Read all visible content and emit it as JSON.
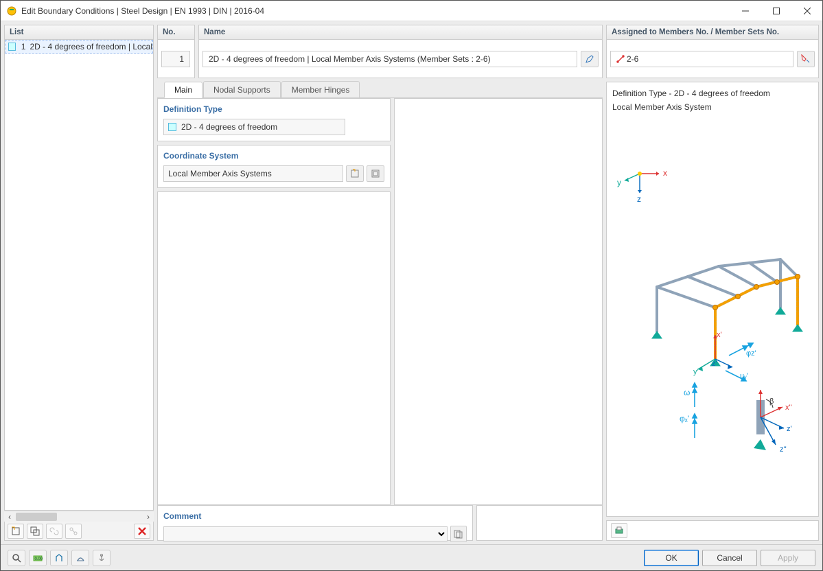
{
  "window": {
    "title": "Edit Boundary Conditions | Steel Design | EN 1993 | DIN | 2016-04"
  },
  "list": {
    "header": "List",
    "rows": [
      {
        "num": "1",
        "text": "2D - 4 degrees of freedom | Local"
      }
    ]
  },
  "fields": {
    "no_label": "No.",
    "no_value": "1",
    "name_label": "Name",
    "name_value": "2D - 4 degrees of freedom | Local Member Axis Systems (Member Sets : 2-6)",
    "assigned_label": "Assigned to Members No. / Member Sets No.",
    "assigned_value": "2-6"
  },
  "tabs": {
    "items": [
      "Main",
      "Nodal Supports",
      "Member Hinges"
    ]
  },
  "defType": {
    "label": "Definition Type",
    "value": "2D - 4 degrees of freedom"
  },
  "coord": {
    "label": "Coordinate System",
    "value": "Local Member Axis Systems"
  },
  "preview": {
    "line1": "Definition Type - 2D - 4 degrees of freedom",
    "line2": "Local Member Axis System"
  },
  "axis": {
    "x": "x",
    "y": "y",
    "z": "z"
  },
  "symbols": {
    "xp": "x'",
    "zp": "z'",
    "yp": "y'",
    "omega": "ω",
    "phix": "φₓ'",
    "phiz": "φz'",
    "uy": "uᵧ'",
    "x2": "x''",
    "z2": "z'",
    "z2b": "z''",
    "beta": "β"
  },
  "comment": {
    "label": "Comment",
    "value": ""
  },
  "buttons": {
    "ok": "OK",
    "cancel": "Cancel",
    "apply": "Apply"
  }
}
